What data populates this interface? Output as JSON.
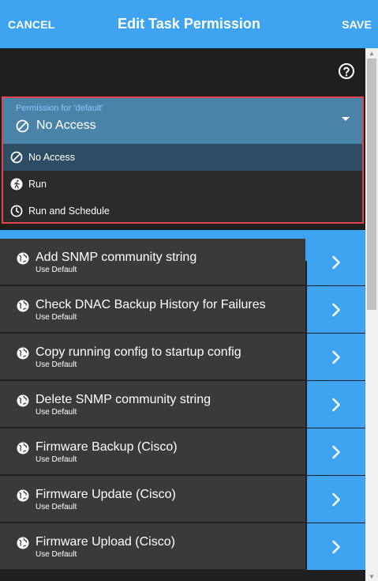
{
  "header": {
    "cancel": "CANCEL",
    "title": "Edit Task Permission",
    "save": "SAVE"
  },
  "permission": {
    "label": "Permission for 'default'",
    "selected": "No Access",
    "options": [
      "No Access",
      "Run",
      "Run and Schedule"
    ]
  },
  "tasks": [
    {
      "name": "Add SNMP community string",
      "sub": "Use Default"
    },
    {
      "name": "Check DNAC Backup History for Failures",
      "sub": "Use Default"
    },
    {
      "name": "Copy running config to startup config",
      "sub": "Use Default"
    },
    {
      "name": "Delete SNMP community string",
      "sub": "Use Default"
    },
    {
      "name": "Firmware Backup (Cisco)",
      "sub": "Use Default"
    },
    {
      "name": "Firmware Update (Cisco)",
      "sub": "Use Default"
    },
    {
      "name": "Firmware Upload (Cisco)",
      "sub": "Use Default"
    }
  ],
  "colors": {
    "accent": "#3ea3f0",
    "highlight_border": "#e0454a",
    "row_bg": "#3a3a3a"
  }
}
